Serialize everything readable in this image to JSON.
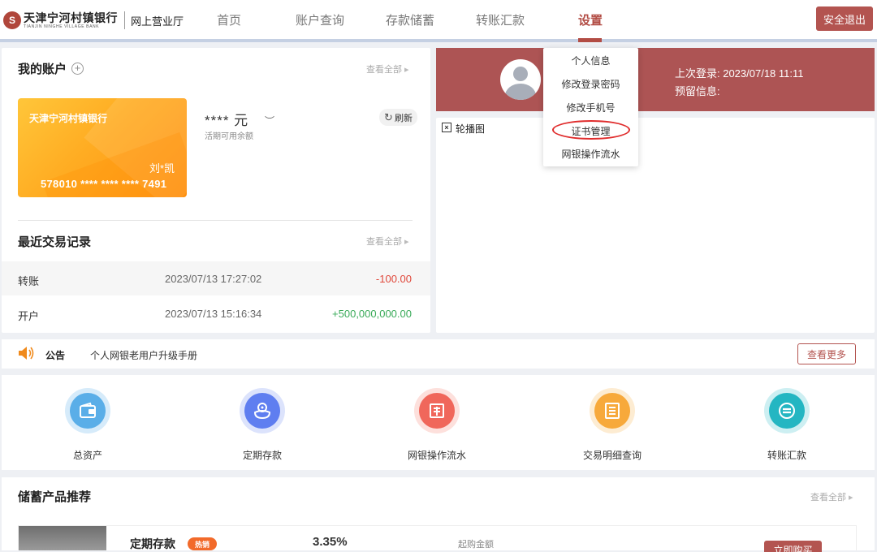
{
  "header": {
    "logo_name": "天津宁河村镇银行",
    "logo_en": "TIANJIN NINGHE VILLAGE BANK",
    "logo_sub": "网上营业厅",
    "nav": [
      "首页",
      "账户查询",
      "存款储蓄",
      "转账汇款",
      "设置"
    ],
    "active_nav": "设置",
    "logout": "安全退出"
  },
  "settings_menu": {
    "items": [
      "个人信息",
      "修改登录密码",
      "修改手机号",
      "证书管理",
      "网银操作流水"
    ],
    "highlighted": "证书管理"
  },
  "account": {
    "title": "我的账户",
    "see_all": "查看全部",
    "card": {
      "bank": "天津宁河村镇银行",
      "holder": "刘*凯",
      "number": "578010 **** **** **** 7491"
    },
    "balance_masked": "**** 元",
    "balance_label": "活期可用余额",
    "refresh": "刷新"
  },
  "transactions": {
    "title": "最近交易记录",
    "see_all": "查看全部",
    "rows": [
      {
        "type": "转账",
        "time": "2023/07/13 17:27:02",
        "amount": "-100.00"
      },
      {
        "type": "开户",
        "time": "2023/07/13 15:16:34",
        "amount": "+500,000,000.00"
      }
    ]
  },
  "profile": {
    "last_login": "上次登录: 2023/07/18 11:11",
    "reserved": "预留信息:"
  },
  "carousel": {
    "alt": "轮播图"
  },
  "notice": {
    "label": "公告",
    "text": "个人网银老用户升级手册",
    "more": "查看更多"
  },
  "shortcuts": [
    {
      "label": "总资产",
      "icon": "wallet-icon",
      "color": "#5aaee8",
      "ring": "#d6ebfa"
    },
    {
      "label": "定期存款",
      "icon": "piggy-icon",
      "color": "#5f7ef0",
      "ring": "#dce3fc"
    },
    {
      "label": "网银操作流水",
      "icon": "receipt-icon",
      "color": "#f0675b",
      "ring": "#fde0dc"
    },
    {
      "label": "交易明细查询",
      "icon": "list-icon",
      "color": "#f7a93b",
      "ring": "#fdecd2"
    },
    {
      "label": "转账汇款",
      "icon": "transfer-icon",
      "color": "#24b6c2",
      "ring": "#cdeff2"
    }
  ],
  "products": {
    "title": "储蓄产品推荐",
    "see_all": "查看全部",
    "item": {
      "name": "定期存款",
      "badge": "热销",
      "rate": "3.35%",
      "min_label": "起购金额",
      "buy": "立即购买"
    }
  }
}
